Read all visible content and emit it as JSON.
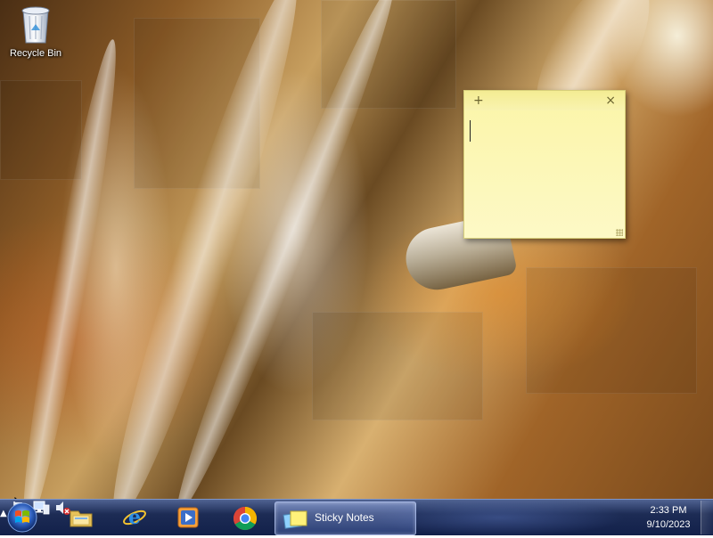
{
  "desktop": {
    "icons": [
      {
        "label": "Recycle Bin",
        "icon": "recycle-bin-icon"
      }
    ]
  },
  "sticky_note": {
    "add_icon": "+",
    "close_icon": "×",
    "text": "",
    "color": "#fdf9c6"
  },
  "taskbar": {
    "start_icon": "windows-logo-icon",
    "pinned": [
      {
        "name": "windows-explorer",
        "icon": "folder-icon"
      },
      {
        "name": "internet-explorer",
        "icon": "internet-explorer-icon"
      },
      {
        "name": "windows-media-player",
        "icon": "media-player-icon"
      },
      {
        "name": "google-chrome",
        "icon": "chrome-icon"
      }
    ],
    "active_task": {
      "label": "Sticky Notes",
      "icon": "sticky-notes-icon"
    },
    "tray": {
      "show_hidden": "▲",
      "icons": [
        "action-center-flag-icon",
        "network-icon",
        "volume-muted-icon"
      ]
    },
    "clock": {
      "time": "2:33 PM",
      "date": "9/10/2023"
    }
  }
}
